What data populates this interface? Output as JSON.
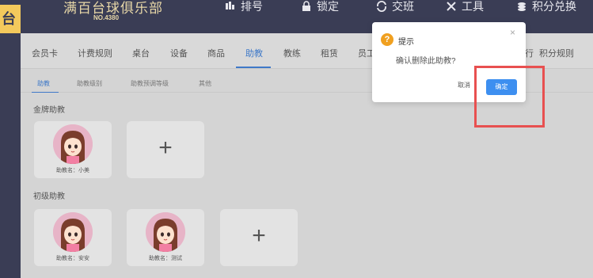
{
  "header": {
    "brand_tab": "台",
    "club_name": "满百台球俱乐部",
    "club_no": "NO.4380",
    "nav": [
      {
        "label": "排号",
        "icon": "queue-icon"
      },
      {
        "label": "锁定",
        "icon": "lock-icon"
      },
      {
        "label": "交班",
        "icon": "shift-icon"
      },
      {
        "label": "工具",
        "icon": "tools-icon"
      },
      {
        "label": "积分兑换",
        "icon": "points-icon"
      }
    ]
  },
  "navbar": {
    "items": [
      "会员卡",
      "计费规则",
      "桌台",
      "设备",
      "商品",
      "助教",
      "教练",
      "租赁",
      "员工",
      "行",
      "积分规则"
    ],
    "active": "助教"
  },
  "subtabs": {
    "items": [
      "助教",
      "助教级别",
      "助教预调等级",
      "其他"
    ],
    "active": "助教"
  },
  "sections": [
    {
      "title": "金牌助教",
      "assistants": [
        {
          "label": "助教名：小美"
        }
      ]
    },
    {
      "title": "初级助教",
      "assistants": [
        {
          "label": "助教名：安安"
        },
        {
          "label": "助教名：测试"
        }
      ]
    }
  ],
  "add_symbol": "+",
  "dialog": {
    "title": "提示",
    "message": "确认删除此助教?",
    "cancel_label": "取消",
    "ok_label": "确定",
    "close_symbol": "×",
    "warn_symbol": "?"
  },
  "colors": {
    "header_bg": "#3a3d55",
    "accent": "#3f79c8",
    "ok_button": "#3d8ff0",
    "warn": "#f0a020",
    "highlight": "#e85050"
  }
}
